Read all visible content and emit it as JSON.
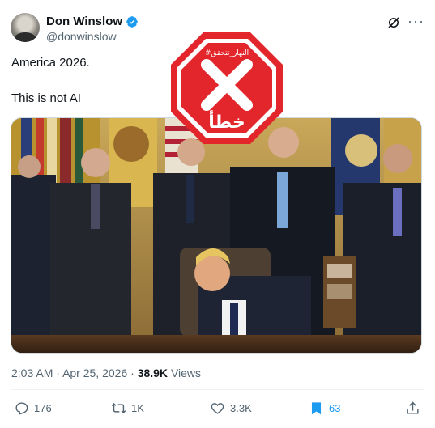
{
  "author": {
    "name": "Don Winslow",
    "handle": "@donwinslow"
  },
  "tweet": {
    "line1": "America 2026.",
    "line2": "This is not AI"
  },
  "stamp": {
    "top_text": "#النهار_تتحقق",
    "verdict": "خطأ",
    "color": "#e3262b"
  },
  "meta": {
    "time": "2:03 AM",
    "separator": "·",
    "date": "Apr 25, 2026",
    "views_count": "38.9K",
    "views_label": "Views"
  },
  "actions": {
    "replies": "176",
    "reposts": "1K",
    "likes": "3.3K",
    "bookmarks": "63"
  },
  "colors": {
    "accent": "#1d9bf0",
    "secondary_text": "#536471"
  },
  "icons": {
    "verified": "verified-badge-icon",
    "grok": "grok-icon",
    "more": "more-icon",
    "reply": "reply-icon",
    "repost": "repost-icon",
    "like": "like-icon",
    "bookmark": "bookmark-icon",
    "share": "share-icon"
  }
}
